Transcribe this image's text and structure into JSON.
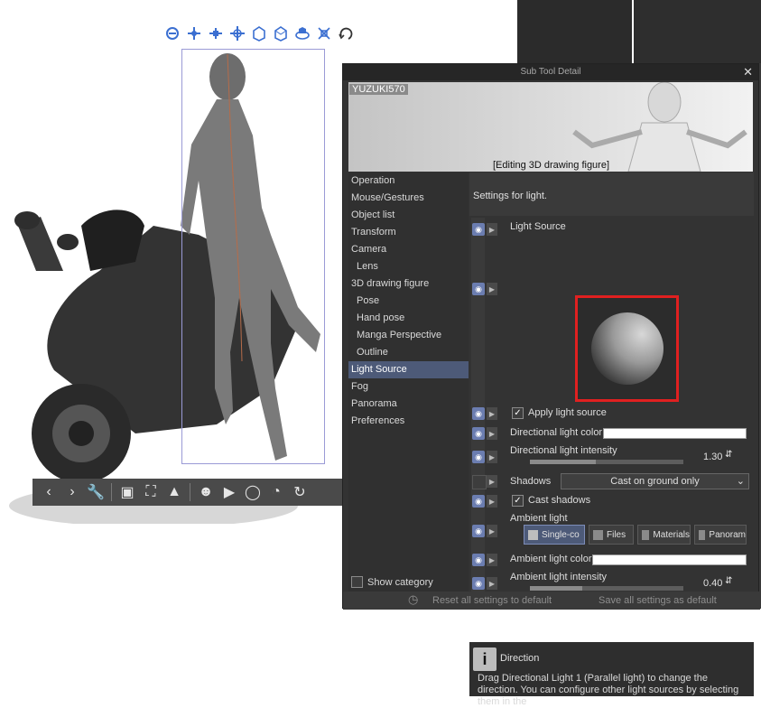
{
  "manipulator": {
    "icons": [
      "camera-rotate-icon",
      "camera-pan-icon",
      "camera-dolly-icon",
      "object-move-icon",
      "object-rotate-x-icon",
      "object-rotate-y-icon",
      "object-rotate-z-icon",
      "object-scale-icon",
      "reset-rotation-icon"
    ]
  },
  "bottom_toolbar": {
    "icons": [
      "prev-icon",
      "next-icon",
      "wrench-icon",
      "camera-fit-icon",
      "selection-fit-icon",
      "ground-icon",
      "register-pose-icon",
      "flip-icon",
      "rotate-joint-icon",
      "reset-pose-icon",
      "lock-icon"
    ]
  },
  "panel": {
    "title": "Sub Tool Detail",
    "close_glyph": "✕",
    "preview_user": "YUZUKI570",
    "preview_caption": "[Editing 3D drawing figure]",
    "nav": [
      {
        "label": "Operation",
        "sub": false,
        "active": false
      },
      {
        "label": "Mouse/Gestures",
        "sub": false,
        "active": false
      },
      {
        "label": "Object list",
        "sub": false,
        "active": false
      },
      {
        "label": "Transform",
        "sub": false,
        "active": false
      },
      {
        "label": "Camera",
        "sub": false,
        "active": false
      },
      {
        "label": "Lens",
        "sub": true,
        "active": false
      },
      {
        "label": "3D drawing figure",
        "sub": false,
        "active": false
      },
      {
        "label": "Pose",
        "sub": true,
        "active": false
      },
      {
        "label": "Hand pose",
        "sub": true,
        "active": false
      },
      {
        "label": "Manga Perspective",
        "sub": true,
        "active": false
      },
      {
        "label": "Outline",
        "sub": true,
        "active": false
      },
      {
        "label": "Light Source",
        "sub": false,
        "active": true
      },
      {
        "label": "Fog",
        "sub": false,
        "active": false
      },
      {
        "label": "Panorama",
        "sub": false,
        "active": false
      },
      {
        "label": "Preferences",
        "sub": false,
        "active": false
      }
    ],
    "show_category": "Show category",
    "settings_for": "Settings for light.",
    "light_source": "Light Source",
    "apply_light_source": "Apply light source",
    "directional_light_color": "Directional light color",
    "directional_light_intensity": "Directional light intensity",
    "directional_light_intensity_value": "1.30",
    "directional_light_intensity_level": 0.43,
    "shadows_label": "Shadows",
    "shadows_value": "Cast on ground only",
    "cast_shadows": "Cast shadows",
    "ambient_light": "Ambient light",
    "ambient_modes": [
      {
        "label": "Single-co",
        "icon": "single-color-icon",
        "active": true
      },
      {
        "label": "Files",
        "icon": "file-icon",
        "active": false
      },
      {
        "label": "Materials",
        "icon": "materials-icon",
        "active": false
      },
      {
        "label": "Panoram",
        "icon": "panorama-icon",
        "active": false
      }
    ],
    "ambient_light_color": "Ambient light color",
    "ambient_light_intensity": "Ambient light intensity",
    "ambient_light_intensity_value": "0.40",
    "ambient_light_intensity_level": 0.34,
    "direction_title": "Direction",
    "direction_text": "Drag Directional Light 1 (Parallel light) to change the direction. You can configure other light sources by selecting them in the",
    "reset_button": "Reset all settings to default",
    "save_button": "Save all settings as default",
    "colors": {
      "accent": "#4d5a78",
      "highlight_box": "#e02020",
      "panel_bg": "#333333"
    }
  }
}
